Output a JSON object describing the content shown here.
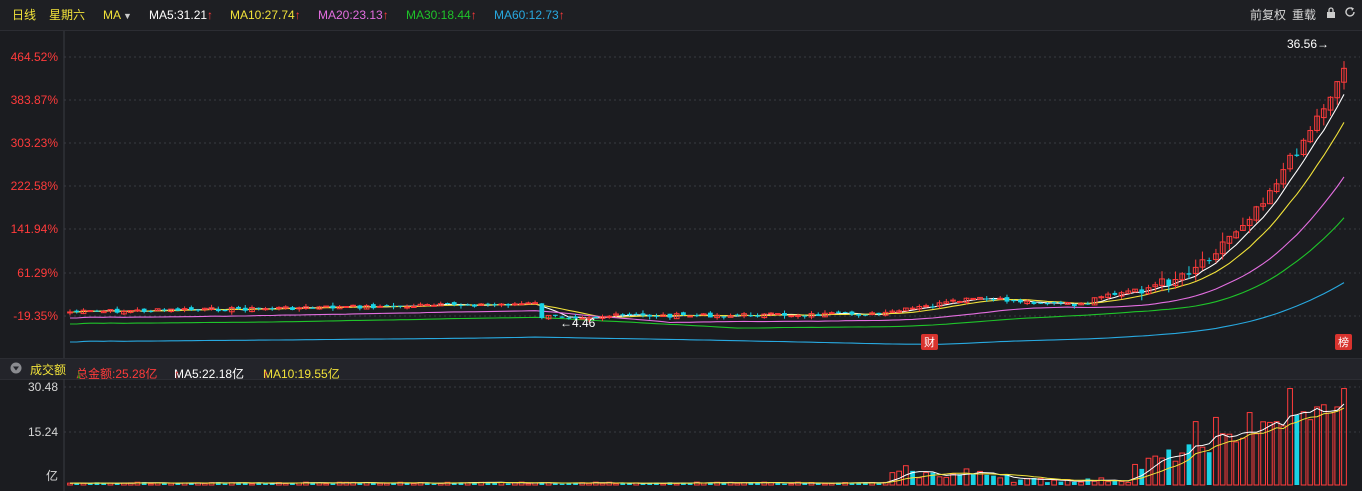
{
  "header": {
    "period": "日线",
    "weekday": "星期六",
    "indicator": "MA",
    "ma": [
      {
        "label": "MA5:31.21",
        "color": "#ffffff",
        "arrow": "↑"
      },
      {
        "label": "MA10:27.74",
        "color": "#f2e33a",
        "arrow": "↑"
      },
      {
        "label": "MA20:23.13",
        "color": "#e36ee0",
        "arrow": "↑"
      },
      {
        "label": "MA30:18.44",
        "color": "#1fc42a",
        "arrow": "↑"
      },
      {
        "label": "MA60:12.73",
        "color": "#28a9e0",
        "arrow": "↑"
      }
    ],
    "fq_label": "前复权",
    "reload_label": "重载"
  },
  "volume_header": {
    "title": "成交额",
    "total_label": "总金额:25.28亿",
    "total_arrow": "↓",
    "ma5_label": "MA5:22.18亿",
    "ma5_arrow": "↑",
    "ma10_label": "MA10:19.55亿",
    "ma10_arrow": "↑"
  },
  "chart_data": [
    {
      "type": "candlestick",
      "yaxis_ticks": [
        "464.52%",
        "383.87%",
        "303.23%",
        "222.58%",
        "141.94%",
        "61.29%",
        "-19.35%"
      ],
      "ylim_percent": [
        -19.35,
        464.52
      ],
      "annotations": {
        "max_label": "36.56→",
        "min_label": "←4.46",
        "event_badge_1": "财",
        "event_badge_2": "榜"
      },
      "colors": {
        "up": "#ff3b3b",
        "down": "#19d3e6",
        "ma5": "#ffffff",
        "ma10": "#f2e33a",
        "ma20": "#e36ee0",
        "ma30": "#1fc42a",
        "ma60": "#28a9e0",
        "grid": "#3a3b42"
      }
    },
    {
      "type": "bar",
      "yaxis_ticks": [
        "30.48",
        "15.24",
        "亿"
      ],
      "ylim": [
        0,
        30.48
      ],
      "unit": "亿"
    }
  ]
}
